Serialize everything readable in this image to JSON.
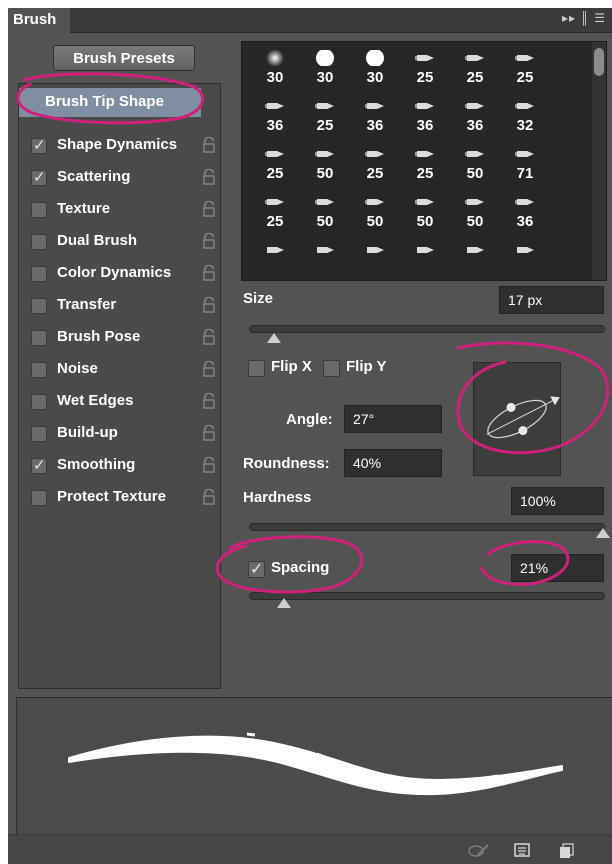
{
  "panel": {
    "tab_label": "Brush",
    "menu_glyphs": "▸▸ ║ ☰"
  },
  "left": {
    "presets_button": "Brush Presets",
    "tip_shape": "Brush Tip Shape",
    "items": [
      {
        "label": "Shape Dynamics",
        "checked": true
      },
      {
        "label": "Scattering",
        "checked": true
      },
      {
        "label": "Texture",
        "checked": false
      },
      {
        "label": "Dual Brush",
        "checked": false
      },
      {
        "label": "Color Dynamics",
        "checked": false
      },
      {
        "label": "Transfer",
        "checked": false
      },
      {
        "label": "Brush Pose",
        "checked": false
      },
      {
        "label": "Noise",
        "checked": false
      },
      {
        "label": "Wet Edges",
        "checked": false
      },
      {
        "label": "Build-up",
        "checked": false
      },
      {
        "label": "Smoothing",
        "checked": true
      },
      {
        "label": "Protect Texture",
        "checked": false
      }
    ]
  },
  "brushes": {
    "rows": [
      [
        {
          "size": "30",
          "shape": "soft"
        },
        {
          "size": "30",
          "shape": "hard"
        },
        {
          "size": "30",
          "shape": "hard"
        },
        {
          "size": "25",
          "shape": "tip"
        },
        {
          "size": "25",
          "shape": "tip"
        },
        {
          "size": "25",
          "shape": "tip"
        }
      ],
      [
        {
          "size": "36",
          "shape": "tip"
        },
        {
          "size": "25",
          "shape": "tip"
        },
        {
          "size": "36",
          "shape": "tip"
        },
        {
          "size": "36",
          "shape": "tip"
        },
        {
          "size": "36",
          "shape": "tip"
        },
        {
          "size": "32",
          "shape": "tip"
        }
      ],
      [
        {
          "size": "25",
          "shape": "tip"
        },
        {
          "size": "50",
          "shape": "tip"
        },
        {
          "size": "25",
          "shape": "tip"
        },
        {
          "size": "25",
          "shape": "tip"
        },
        {
          "size": "50",
          "shape": "tip"
        },
        {
          "size": "71",
          "shape": "tip"
        }
      ],
      [
        {
          "size": "25",
          "shape": "tip"
        },
        {
          "size": "50",
          "shape": "tip"
        },
        {
          "size": "50",
          "shape": "tip"
        },
        {
          "size": "50",
          "shape": "tip"
        },
        {
          "size": "50",
          "shape": "tip"
        },
        {
          "size": "36",
          "shape": "tip"
        }
      ]
    ]
  },
  "controls": {
    "size_label": "Size",
    "size_value": "17 px",
    "size_slider_fraction": 0.07,
    "flip_x": "Flip X",
    "flip_y": "Flip Y",
    "angle_label": "Angle:",
    "angle_value": "27°",
    "roundness_label": "Roundness:",
    "roundness_value": "40%",
    "hardness_label": "Hardness",
    "hardness_value": "100%",
    "hardness_slider_fraction": 1.0,
    "spacing_label": "Spacing",
    "spacing_checked": true,
    "spacing_value": "21%",
    "spacing_slider_fraction": 0.1
  },
  "colors": {
    "panel_bg": "#535353",
    "highlight": "#7f8fa1",
    "annotation": "#d0217a"
  },
  "footer_icons": [
    "brush-toggle-icon",
    "grid-icon",
    "new-preset-icon"
  ]
}
